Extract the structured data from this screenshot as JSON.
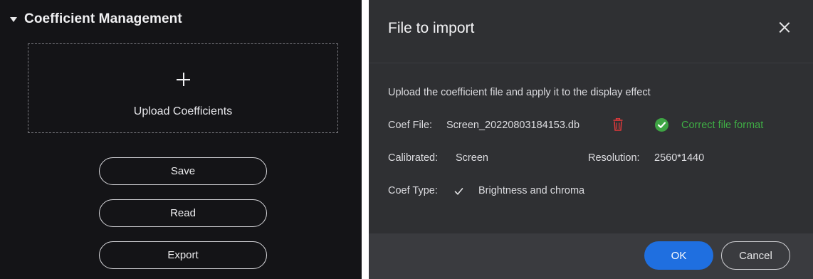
{
  "left_panel": {
    "title": "Coefficient Management",
    "upload_label": "Upload Coefficients",
    "buttons": {
      "save": "Save",
      "read": "Read",
      "export": "Export"
    }
  },
  "dialog": {
    "title": "File to import",
    "description": "Upload the coefficient file and apply it to the display effect",
    "coef_file": {
      "label": "Coef File:",
      "value": "Screen_20220803184153.db"
    },
    "status": {
      "text": "Correct file format",
      "color": "#3fae45"
    },
    "calibrated": {
      "label": "Calibrated:",
      "value": "Screen"
    },
    "resolution": {
      "label": "Resolution:",
      "value": "2560*1440"
    },
    "coef_type": {
      "label": "Coef Type:",
      "value": "Brightness and chroma"
    },
    "buttons": {
      "ok": "OK",
      "cancel": "Cancel"
    }
  },
  "colors": {
    "panel_bg": "#141417",
    "dialog_bg": "#2f3033",
    "primary": "#1f6fe0",
    "success": "#3ea444",
    "danger": "#e0393b"
  },
  "icons": [
    "caret-down-icon",
    "plus-icon",
    "close-icon",
    "trash-icon",
    "check-circle-icon",
    "checkmark-icon"
  ]
}
